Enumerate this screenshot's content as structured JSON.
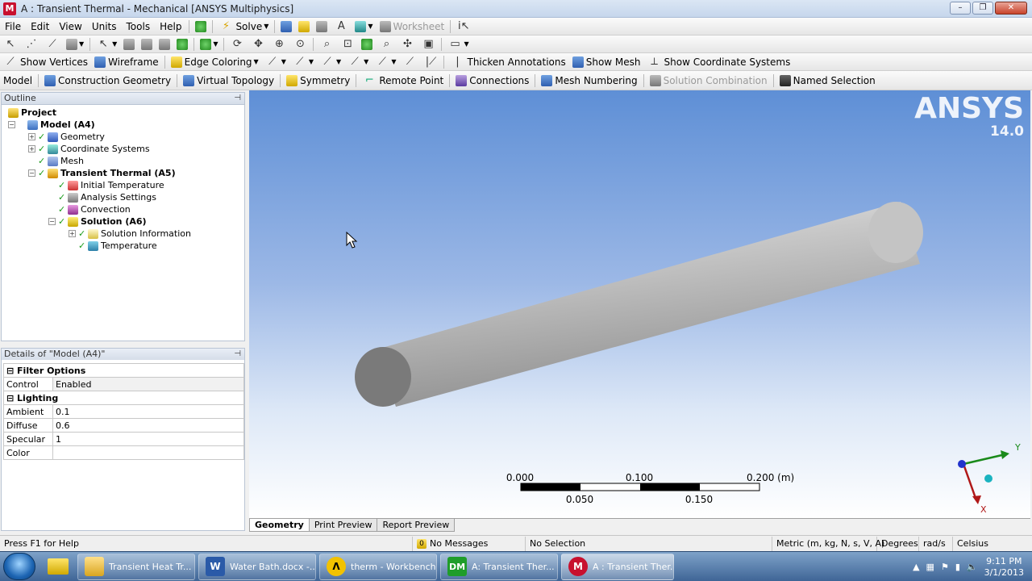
{
  "window": {
    "title": "A : Transient Thermal - Mechanical [ANSYS Multiphysics]",
    "app_badge": "M",
    "minimize": "–",
    "maximize": "❐",
    "close": "✕"
  },
  "menu": {
    "items": [
      "File",
      "Edit",
      "View",
      "Units",
      "Tools",
      "Help"
    ],
    "solve": "Solve",
    "worksheet": "Worksheet"
  },
  "toolbar3": {
    "show_vertices": "Show Vertices",
    "wireframe": "Wireframe",
    "edge_coloring": "Edge Coloring",
    "thicken_annotations": "Thicken Annotations",
    "show_mesh": "Show Mesh",
    "show_coordinate_systems": "Show Coordinate Systems"
  },
  "toolbar4": {
    "model": "Model",
    "construction_geometry": "Construction Geometry",
    "virtual_topology": "Virtual Topology",
    "symmetry": "Symmetry",
    "remote_point": "Remote Point",
    "connections": "Connections",
    "mesh_numbering": "Mesh Numbering",
    "solution_combination": "Solution Combination",
    "named_selection": "Named Selection"
  },
  "outline": {
    "title": "Outline",
    "pin": "⊣",
    "project": "Project",
    "model": "Model (A4)",
    "geometry": "Geometry",
    "coordinate_systems": "Coordinate Systems",
    "mesh": "Mesh",
    "transient_thermal": "Transient Thermal (A5)",
    "initial_temperature": "Initial Temperature",
    "analysis_settings": "Analysis Settings",
    "convection": "Convection",
    "solution": "Solution (A6)",
    "solution_information": "Solution Information",
    "temperature": "Temperature"
  },
  "details": {
    "title": "Details of \"Model (A4)\"",
    "pin": "⊣",
    "filter_options": "Filter Options",
    "control_key": "Control",
    "control_val": "Enabled",
    "lighting": "Lighting",
    "ambient_key": "Ambient",
    "ambient_val": "0.1",
    "diffuse_key": "Diffuse",
    "diffuse_val": "0.6",
    "specular_key": "Specular",
    "specular_val": "1",
    "color_key": "Color",
    "color_val": ""
  },
  "viewport": {
    "brand": "ANSYS",
    "version": "14.0",
    "scale": {
      "l0": "0.000",
      "l1": "0.100",
      "l2": "0.200 (m)",
      "l3": "0.050",
      "l4": "0.150"
    },
    "triad": {
      "y": "Y",
      "x": "X"
    }
  },
  "tabs": [
    "Geometry",
    "Print Preview",
    "Report Preview"
  ],
  "status": {
    "help": "Press F1 for Help",
    "messages_count": "0",
    "messages": "No Messages",
    "selection": "No Selection",
    "units": "Metric (m, kg, N, s, V, A)",
    "degrees": "Degrees",
    "rads": "rad/s",
    "celsius": "Celsius"
  },
  "taskbar": {
    "tasks": [
      {
        "label": "Transient Heat Tr...",
        "badge": ""
      },
      {
        "label": "Water Bath.docx -...",
        "badge": "W"
      },
      {
        "label": "therm - Workbench",
        "badge": "Λ"
      },
      {
        "label": "A: Transient Ther...",
        "badge": "DM"
      },
      {
        "label": "A : Transient Ther...",
        "badge": "M"
      }
    ],
    "time": "9:11 PM",
    "date": "3/1/2013"
  },
  "colors": {
    "viewport_top": "#5e8fd6",
    "viewport_bottom": "#ffffff",
    "cylinder": "#b8b8b8",
    "accent_ansys": "#c8102e"
  }
}
